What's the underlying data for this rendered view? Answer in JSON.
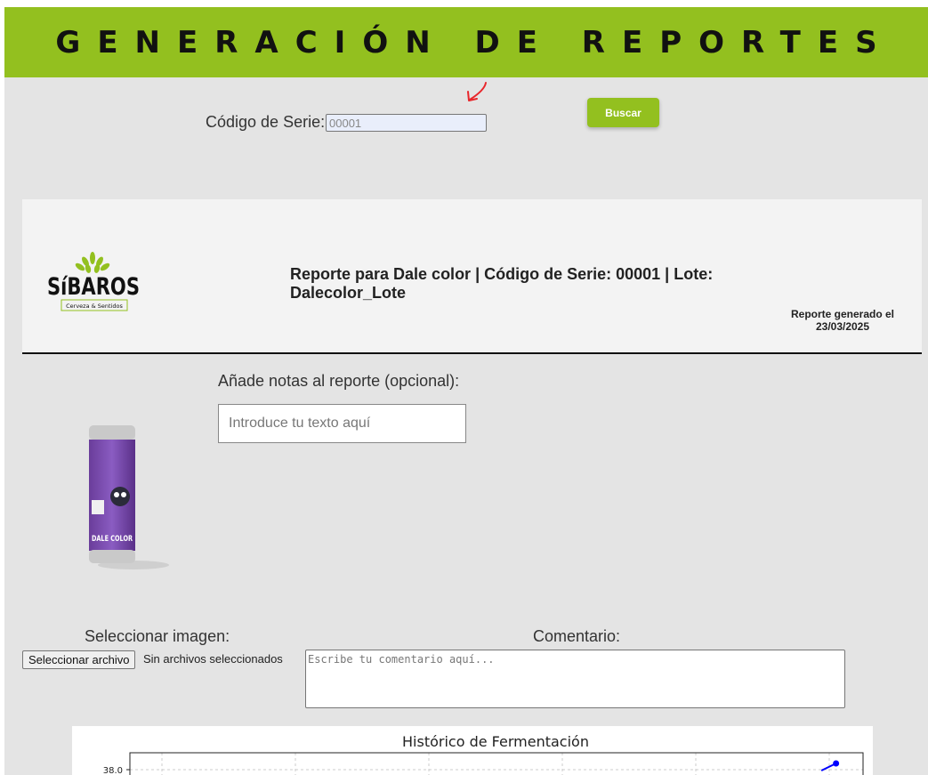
{
  "header": {
    "title": "GENERACIÓN DE REPORTES"
  },
  "search": {
    "label": "Código de Serie:",
    "value": "00001",
    "button_label": "Buscar"
  },
  "report": {
    "title": "Reporte para Dale color | Código de Serie: 00001 | Lote: Dalecolor_Lote",
    "generated": "Reporte generado el 23/03/2025",
    "logo_text": "SíBAROS",
    "logo_tagline": "Cerveza & Sentidos",
    "can_text": "DALE COLOR"
  },
  "notes": {
    "label": "Añade notas al reporte (opcional):",
    "placeholder": "Introduce tu texto aquí"
  },
  "image_upload": {
    "label": "Seleccionar imagen:",
    "button_label": "Seleccionar archivo",
    "status": "Sin archivos seleccionados"
  },
  "comment": {
    "label": "Comentario:",
    "placeholder": "Escribe tu comentario aquí..."
  },
  "colors": {
    "accent": "#93c01f",
    "page_bg": "#e4e4e4",
    "header_panel_bg": "#f3f3f3",
    "series_color": "#0000ff",
    "annotation_arrow": "#e8262b"
  },
  "chart_data": {
    "type": "line",
    "title": "Histórico de Fermentación",
    "y_tick_labels": [
      "38.0"
    ],
    "grid": true,
    "series": [
      {
        "x": [
          0.985,
          0.965
        ],
        "values": [
          38.0,
          37.5
        ]
      }
    ]
  }
}
